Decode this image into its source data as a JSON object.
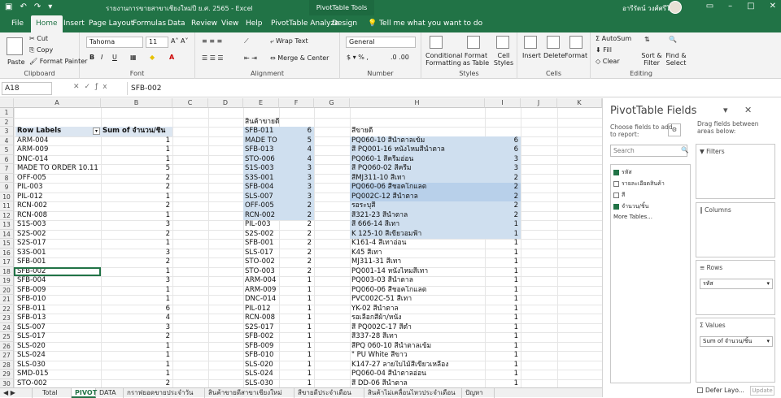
{
  "titlebar": {
    "document_title": "รายงานการขายสาขาเชียงใหม่ปี ย.ศ. 2565 - Excel",
    "context_label": "PivotTable Tools",
    "user_name": "อารีรัตน์ วงศ์ศรีไสย์"
  },
  "tabs": [
    "File",
    "Home",
    "Insert",
    "Page Layout",
    "Formulas",
    "Data",
    "Review",
    "View",
    "Help",
    "PivotTable Analyze",
    "Design"
  ],
  "tell_me": "Tell me what you want to do",
  "ribbon": {
    "paste": "Paste",
    "cut": "Cut",
    "copy": "Copy",
    "format_painter": "Format Painter",
    "clipboard": "Clipboard",
    "font_name": "Tahoma",
    "font_size": "11",
    "font": "Font",
    "wrap_text": "Wrap Text",
    "merge_center": "Merge & Center",
    "alignment": "Alignment",
    "number_format": "General",
    "number": "Number",
    "conditional_formatting": "Conditional Formatting",
    "format_as_table": "Format as Table",
    "cell_styles": "Cell Styles",
    "styles": "Styles",
    "insert": "Insert",
    "delete": "Delete",
    "format": "Format",
    "cells": "Cells",
    "autosum": "AutoSum",
    "fill": "Fill",
    "clear": "Clear",
    "sort_filter": "Sort & Filter",
    "find_select": "Find & Select",
    "editing": "Editing"
  },
  "formula_bar": {
    "name_box": "A18",
    "value": "SFB-002"
  },
  "columns": [
    "A",
    "B",
    "C",
    "D",
    "E",
    "F",
    "G",
    "H",
    "I",
    "J",
    "K"
  ],
  "rows": [
    "1",
    "2",
    "3",
    "4",
    "5",
    "6",
    "7",
    "8",
    "9",
    "10",
    "11",
    "12",
    "13",
    "14",
    "15",
    "16",
    "17",
    "18",
    "19",
    "20",
    "21",
    "22",
    "23",
    "24",
    "25",
    "26",
    "27",
    "28",
    "29",
    "30",
    "31",
    "32"
  ],
  "pivot": {
    "header_labels": "Row Labels",
    "header_sum": "Sum of จำนวน/ชิ้น",
    "rows": [
      [
        "ARM-004",
        "1"
      ],
      [
        "ARM-009",
        "1"
      ],
      [
        "DNC-014",
        "1"
      ],
      [
        "MADE TO ORDER 10.11",
        "5"
      ],
      [
        "OFF-005",
        "2"
      ],
      [
        "PIL-003",
        "2"
      ],
      [
        "PIL-012",
        "1"
      ],
      [
        "RCN-002",
        "2"
      ],
      [
        "RCN-008",
        "1"
      ],
      [
        "S1S-003",
        "3"
      ],
      [
        "S2S-002",
        "2"
      ],
      [
        "S2S-017",
        "1"
      ],
      [
        "S3S-001",
        "3"
      ],
      [
        "SFB-001",
        "2"
      ],
      [
        "SFB-002",
        "1"
      ],
      [
        "SFB-004",
        "3"
      ],
      [
        "SFB-009",
        "1"
      ],
      [
        "SFB-010",
        "1"
      ],
      [
        "SFB-011",
        "6"
      ],
      [
        "SFB-013",
        "4"
      ],
      [
        "SLS-007",
        "3"
      ],
      [
        "SLS-017",
        "2"
      ],
      [
        "SLS-020",
        "1"
      ],
      [
        "SLS-024",
        "1"
      ],
      [
        "SLS-030",
        "1"
      ],
      [
        "SMD-015",
        "1"
      ],
      [
        "STO-002",
        "2"
      ]
    ]
  },
  "best_sellers": {
    "title": "สินค้าขายดี",
    "rows": [
      [
        "SFB-011",
        "6"
      ],
      [
        "MADE TO",
        "5"
      ],
      [
        "SFB-013",
        "4"
      ],
      [
        "STO-006",
        "4"
      ],
      [
        "S1S-003",
        "3"
      ],
      [
        "S3S-001",
        "3"
      ],
      [
        "SFB-004",
        "3"
      ],
      [
        "SLS-007",
        "3"
      ],
      [
        "OFF-005",
        "2"
      ],
      [
        "RCN-002",
        "2"
      ],
      [
        "PIL-003",
        "2"
      ],
      [
        "S2S-002",
        "2"
      ],
      [
        "SFB-001",
        "2"
      ],
      [
        "SLS-017",
        "2"
      ],
      [
        "STO-002",
        "2"
      ],
      [
        "STO-003",
        "2"
      ],
      [
        "ARM-004",
        "1"
      ],
      [
        "ARM-009",
        "1"
      ],
      [
        "DNC-014",
        "1"
      ],
      [
        "PIL-012",
        "1"
      ],
      [
        "RCN-008",
        "1"
      ],
      [
        "S2S-017",
        "1"
      ],
      [
        "SFB-002",
        "1"
      ],
      [
        "SFB-009",
        "1"
      ],
      [
        "SFB-010",
        "1"
      ],
      [
        "SLS-020",
        "1"
      ],
      [
        "SLS-024",
        "1"
      ],
      [
        "SLS-030",
        "1"
      ]
    ]
  },
  "best_colors": {
    "title": "สีขายดี",
    "rows": [
      [
        "PQ060-10 สีน้ำตาลเข้ม",
        "6"
      ],
      [
        "สี PQ001-16 หนังไหมสีน้ำตาล",
        "6"
      ],
      [
        "PQ060-1 สีครีมอ่อน",
        "3"
      ],
      [
        "สี PQ060-02 สีครีม",
        "3"
      ],
      [
        "สีMJ311-10 สีเทา",
        "2"
      ],
      [
        "PQ060-06 สีชอคโกแลต",
        "2"
      ],
      [
        "PQ002C-12 สีน้ำตาล",
        "2"
      ],
      [
        "รอระบุสี",
        "2"
      ],
      [
        "สี321-23 สีน้ำตาล",
        "2"
      ],
      [
        "สี 666-14 สีเทา",
        "1"
      ],
      [
        "K 125-10 สีเขียวอมฟ้า",
        "1"
      ],
      [
        "K161-4 สีเทาอ่อน",
        "1"
      ],
      [
        "K45 สีเทา",
        "1"
      ],
      [
        "MJ311-31 สีเทา",
        "1"
      ],
      [
        "PQ001-14 หนังไหมสีเทา",
        "1"
      ],
      [
        "PQ003-03 สีน้ำตาล",
        "1"
      ],
      [
        "PQ060-06 สีชอคโกแลต",
        "1"
      ],
      [
        "PVC002C-51 สีเทา",
        "1"
      ],
      [
        "YK-02 สีน้ำตาล",
        "1"
      ],
      [
        "รอเลือกสีผ้า/หนัง",
        "1"
      ],
      [
        "สี PQ002C-17 สีดำ",
        "1"
      ],
      [
        "สี337-28 สีเทา",
        "1"
      ],
      [
        "สีPQ 060-10 สีน้ำตาลเข้ม",
        "1"
      ],
      [
        "\" PU White สีขาว",
        "1"
      ],
      [
        "K147-27 ลายใบไม้สีเขียวเหลือง",
        "1"
      ],
      [
        "PQ060-04 สีน้ำตาลอ่อน",
        "1"
      ],
      [
        "สี DD-06 สีน้ำตาล",
        "1"
      ]
    ]
  },
  "sheet_tabs": [
    "Total",
    "PIVOT",
    "DATA",
    "กราฟยอดขายประจำวัน",
    "สินค้าขายดีสาขาเชียงใหม่",
    "สีขายดีประจำเดือน",
    "สินค้าไม่เคลื่อนไหวประจำเดือน",
    "ปัญหา"
  ],
  "pivot_pane": {
    "title": "PivotTable Fields",
    "choose_label": "Choose fields to add to report:",
    "drag_label": "Drag fields between areas below:",
    "search_placeholder": "Search",
    "fields": [
      {
        "name": "รหัส",
        "checked": true
      },
      {
        "name": "รายละเอียดสินค้า",
        "checked": false
      },
      {
        "name": "สี",
        "checked": false
      },
      {
        "name": "จำนวน/ชิ้น",
        "checked": true
      }
    ],
    "more_tables": "More Tables...",
    "filters": "Filters",
    "columns": "Columns",
    "rows": "Rows",
    "values": "Values",
    "rows_item": "รหัส",
    "values_item": "Sum of จำนวน/ชิ้น",
    "defer": "Defer Layo...",
    "update": "Update"
  }
}
